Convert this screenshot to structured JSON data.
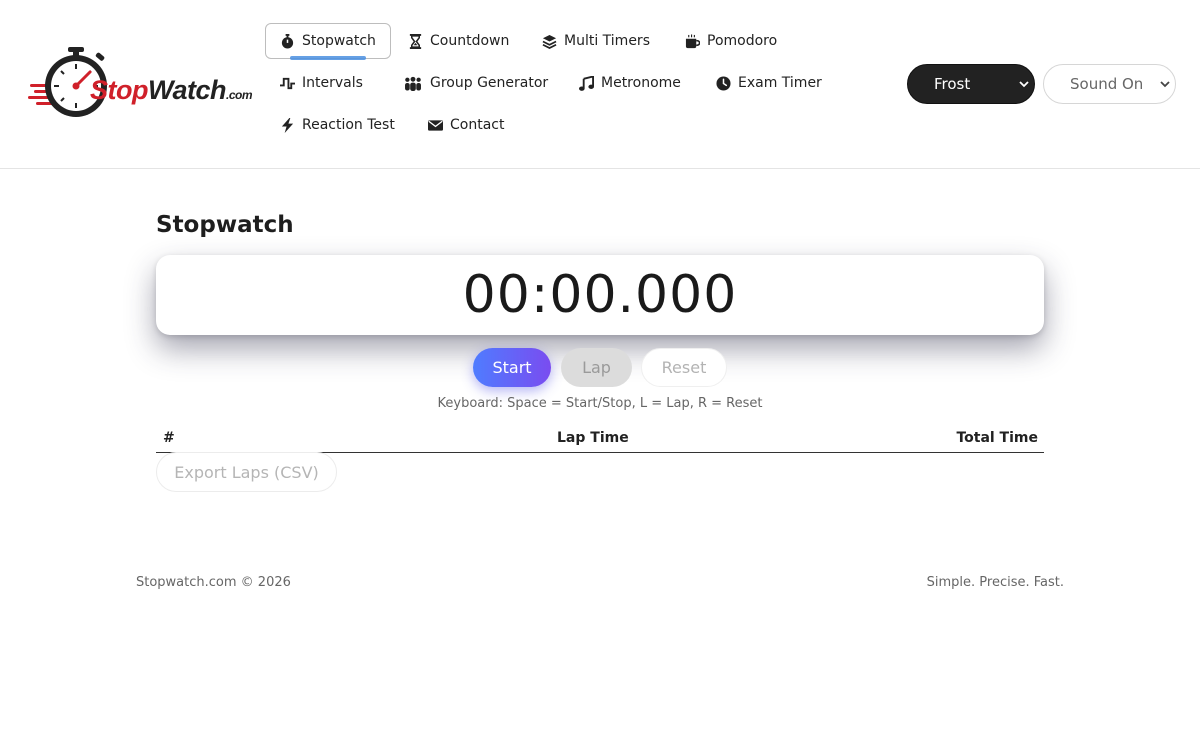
{
  "brand": {
    "logo_main": "Stop",
    "logo_w": "Watch",
    "logo_suffix": ".com"
  },
  "nav": {
    "items": [
      {
        "label": "Stopwatch",
        "icon": "stopwatch-icon",
        "active": true
      },
      {
        "label": "Countdown",
        "icon": "hourglass-icon"
      },
      {
        "label": "Multi Timers",
        "icon": "layers-icon"
      },
      {
        "label": "Pomodoro",
        "icon": "coffee-icon"
      },
      {
        "label": "Intervals",
        "icon": "wave-icon"
      },
      {
        "label": "Group Generator",
        "icon": "group-icon"
      },
      {
        "label": "Metronome",
        "icon": "music-note-icon"
      },
      {
        "label": "Exam Timer",
        "icon": "clock-icon"
      },
      {
        "label": "Reaction Test",
        "icon": "bolt-icon"
      },
      {
        "label": "Contact",
        "icon": "envelope-icon"
      }
    ]
  },
  "controls": {
    "theme_select": "Frost",
    "sound_select": "Sound On"
  },
  "main": {
    "title": "Stopwatch",
    "display": "00:00.000",
    "buttons": {
      "start": "Start",
      "lap": "Lap",
      "reset": "Reset"
    },
    "hint": "Keyboard: Space = Start/Stop, L = Lap, R = Reset",
    "laps_table": {
      "columns": [
        "#",
        "Lap Time",
        "Total Time"
      ],
      "rows": []
    },
    "export_label": "Export Laps (CSV)"
  },
  "footer": {
    "left": "Stopwatch.com © 2026",
    "right": "Simple. Precise. Fast."
  },
  "colors": {
    "accent_start": "#4f7cff",
    "accent_end": "#7a4cf0",
    "brand_red": "#d0202a",
    "nav_underline": "#4a8fe0"
  }
}
